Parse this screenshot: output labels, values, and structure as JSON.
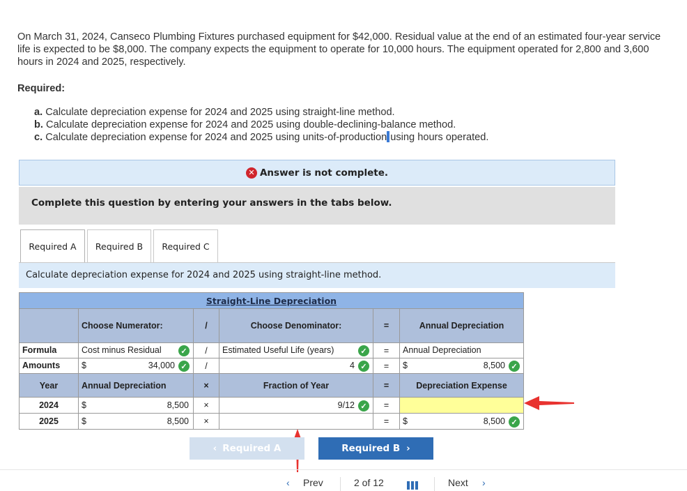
{
  "problem": {
    "text": "On March 31, 2024, Canseco Plumbing Fixtures purchased equipment for $42,000. Residual value at the end of an estimated four-year service life is expected to be $8,000. The company expects the equipment to operate for 10,000 hours. The equipment operated for 2,800 and 3,600 hours in 2024 and 2025, respectively.",
    "required_heading": "Required:",
    "items": [
      {
        "letter": "a.",
        "text": "Calculate depreciation expense for 2024 and 2025 using straight-line method."
      },
      {
        "letter": "b.",
        "text": "Calculate depreciation expense for 2024 and 2025 using double-declining-balance method."
      },
      {
        "letter": "c.",
        "text": "Calculate depreciation expense for 2024 and 2025 using units-of-production",
        "text_after_cursor": "using hours operated."
      }
    ]
  },
  "status": {
    "icon": "x-circle-icon",
    "text": "Answer is not complete."
  },
  "instruction": "Complete this question by entering your answers in the tabs below.",
  "tabs": [
    {
      "label": "Required A",
      "active": true
    },
    {
      "label": "Required B",
      "active": false
    },
    {
      "label": "Required C",
      "active": false
    }
  ],
  "tab_description": "Calculate depreciation expense for 2024 and 2025 using straight-line method.",
  "table": {
    "title": "Straight-Line Depreciation",
    "header": {
      "numerator": "Choose Numerator:",
      "divide": "/",
      "denominator": "Choose Denominator:",
      "equals": "=",
      "result": "Annual Depreciation"
    },
    "formula_row": {
      "label": "Formula",
      "numerator": "Cost minus Residual",
      "divide": "/",
      "denominator": "Estimated Useful Life (years)",
      "equals": "=",
      "result": "Annual Depreciation"
    },
    "amounts_row": {
      "label": "Amounts",
      "currency": "$",
      "numerator": "34,000",
      "divide": "/",
      "denominator": "4",
      "equals": "=",
      "result_currency": "$",
      "result": "8,500"
    },
    "sub_header": {
      "year": "Year",
      "annual": "Annual Depreciation",
      "times": "×",
      "fraction": "Fraction of Year",
      "equals": "=",
      "expense": "Depreciation Expense"
    },
    "rows": [
      {
        "year": "2024",
        "currency": "$",
        "annual": "8,500",
        "times": "×",
        "fraction": "9/12",
        "equals": "=",
        "expense_currency": "",
        "expense": ""
      },
      {
        "year": "2025",
        "currency": "$",
        "annual": "8,500",
        "times": "×",
        "fraction": "",
        "equals": "=",
        "expense_currency": "$",
        "expense": "8,500"
      }
    ]
  },
  "nav": {
    "prev_req": "Required A",
    "next_req": "Required B"
  },
  "pager": {
    "prev": "Prev",
    "page": "2 of 12",
    "next": "Next"
  },
  "colors": {
    "accent": "#2f6db5",
    "check": "#3aa54a",
    "error": "#d0262d",
    "arrow": "#e8322f",
    "highlight": "#ffff99"
  }
}
